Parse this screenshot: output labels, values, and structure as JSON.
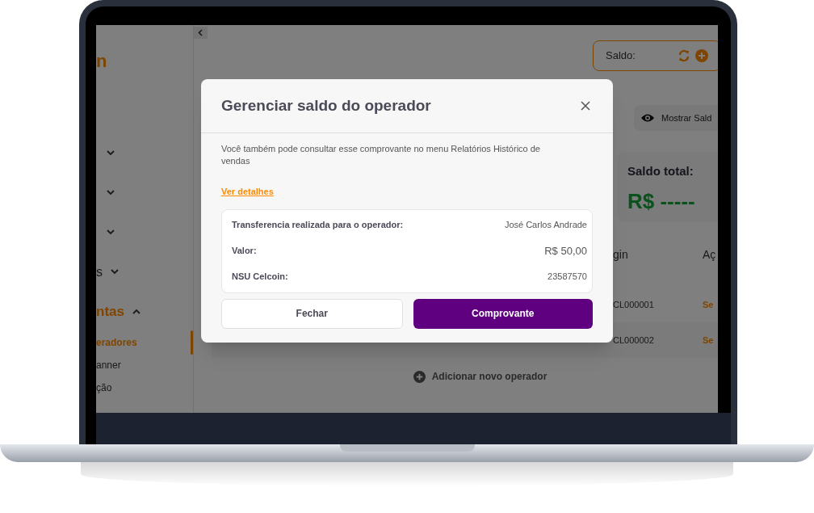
{
  "sidebar": {
    "logo": "n",
    "items": [
      {
        "expanded": false
      },
      {
        "expanded": false
      },
      {
        "expanded": false
      },
      {
        "label": "s",
        "expanded": false
      },
      {
        "label": "ntas",
        "expanded": true,
        "children": [
          {
            "label": "eradores",
            "selected": true
          },
          {
            "label": "anner",
            "selected": false
          },
          {
            "label": "ção",
            "selected": false
          }
        ]
      }
    ]
  },
  "balance_box": {
    "label": "Saldo:"
  },
  "show_balance_button": {
    "label": "Mostrar Sald"
  },
  "total_card": {
    "title": "Saldo total:",
    "value": "R$ -----"
  },
  "table": {
    "columns": [
      "gin",
      "Aç"
    ],
    "rows": [
      [
        "CL000001",
        "Se"
      ],
      [
        "CL000002",
        "Se"
      ]
    ]
  },
  "add_operator": {
    "label": "Adicionar novo operador"
  },
  "modal": {
    "title": "Gerenciar saldo do operador",
    "message": "Você também pode consultar esse comprovante no menu Relatórios Histórico de vendas",
    "link": "Ver detalhes",
    "details": [
      {
        "label": "Transferencia realizada para o operador:",
        "value": "José Carlos Andrade"
      },
      {
        "label": "Valor:",
        "value": "R$ 50,00"
      },
      {
        "label": "NSU Celcoin:",
        "value": "23587570"
      }
    ],
    "buttons": [
      {
        "label": "Fechar",
        "kind": "secondary"
      },
      {
        "label": "Comprovante",
        "kind": "primary"
      }
    ]
  }
}
